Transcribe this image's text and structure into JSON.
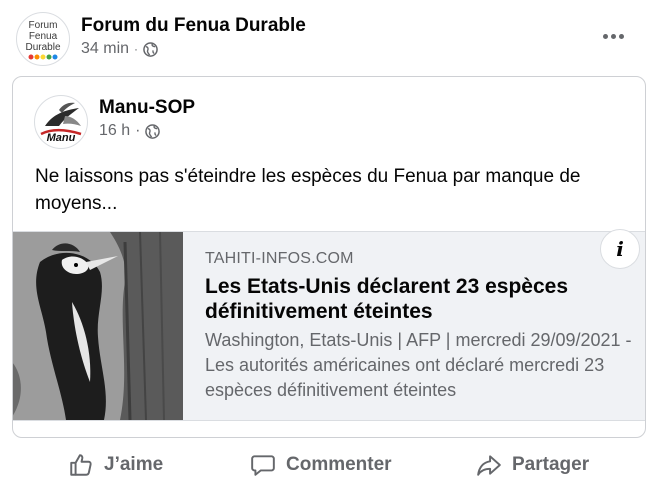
{
  "post": {
    "page_name": "Forum du Fenua Durable",
    "time": "34 min",
    "separator": "·",
    "avatar_text": [
      "Forum",
      "Fenua",
      "Durable"
    ]
  },
  "shared": {
    "author": "Manu-SOP",
    "time": "16 h",
    "separator": "·",
    "avatar_text": "Manu",
    "text": "Ne laissons pas s'éteindre les espèces du Fenua par manque de moyens..."
  },
  "link": {
    "domain": "TAHITI-INFOS.COM",
    "title": "Les Etats-Unis déclarent 23 espèces définitivement éteintes",
    "description": "Washington, Etats-Unis | AFP | mercredi 29/09/2021 - Les autorités américaines ont déclaré mercredi 23 espèces définitivement éteintes",
    "info_icon": "i"
  },
  "actions": {
    "like": "J’aime",
    "comment": "Commenter",
    "share": "Partager"
  },
  "icons": {
    "globe": "globe-icon",
    "more": "more-options-icon",
    "like": "thumbs-up-icon",
    "comment": "comment-bubble-icon",
    "share": "share-arrow-icon",
    "info": "info-icon"
  },
  "colors": {
    "text_primary": "#050505",
    "text_secondary": "#65676b",
    "preview_bg": "#f0f2f5",
    "border": "#ced0d4"
  }
}
